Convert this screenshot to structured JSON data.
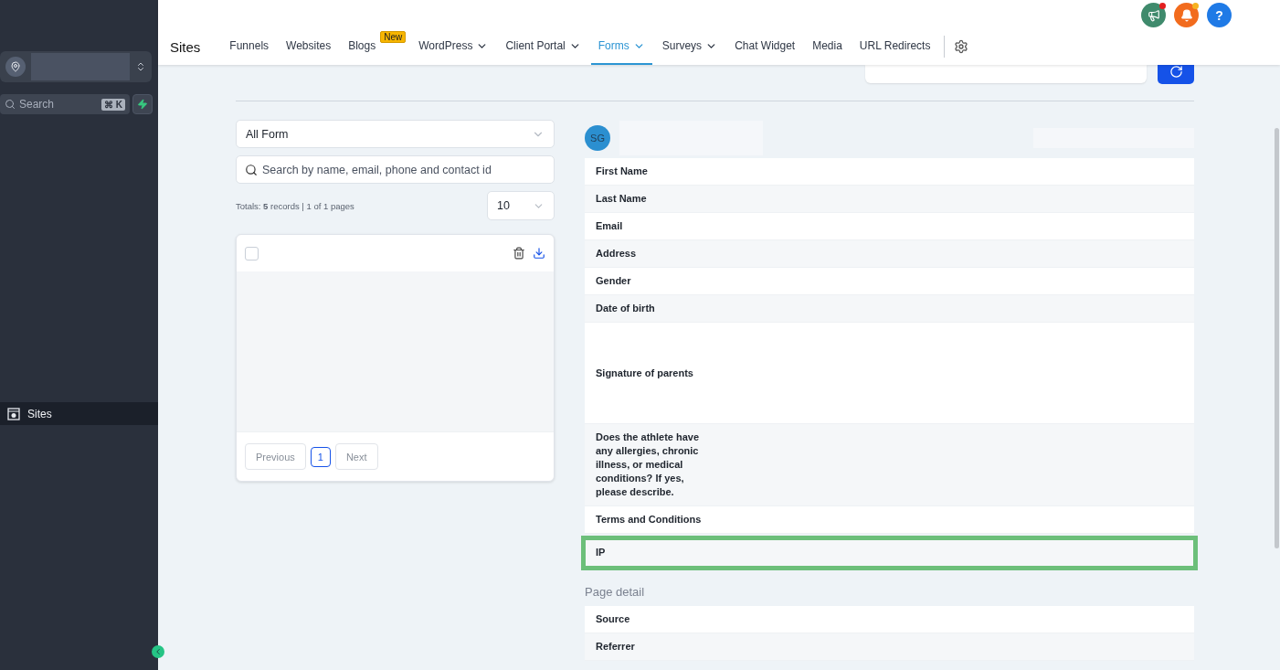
{
  "sidebar": {
    "search": {
      "placeholder": "Search",
      "shortcut": "⌘ K"
    },
    "items": [
      {
        "label": "Sites",
        "selected": true
      }
    ]
  },
  "header": {
    "title": "Sites",
    "tabs": [
      {
        "label": "Funnels",
        "selected": false,
        "dropdown": false
      },
      {
        "label": "Websites",
        "selected": false,
        "dropdown": false
      },
      {
        "label": "Blogs",
        "selected": false,
        "dropdown": false,
        "badge": "New"
      },
      {
        "label": "WordPress",
        "selected": false,
        "dropdown": true
      },
      {
        "label": "Client Portal",
        "selected": false,
        "dropdown": true
      },
      {
        "label": "Forms",
        "selected": true,
        "dropdown": true
      },
      {
        "label": "Surveys",
        "selected": false,
        "dropdown": true
      },
      {
        "label": "Chat Widget",
        "selected": false,
        "dropdown": false
      },
      {
        "label": "Media",
        "selected": false,
        "dropdown": false
      },
      {
        "label": "URL Redirects",
        "selected": false,
        "dropdown": false
      }
    ],
    "actions": [
      {
        "kind": "announcements",
        "unread": true,
        "color": "#3f8a6c"
      },
      {
        "kind": "notifications",
        "unread": true,
        "color": "#f26b1d"
      },
      {
        "kind": "help",
        "label": "?",
        "unread": false,
        "color": "#1f7ae6"
      }
    ]
  },
  "submissions": {
    "form_filter": "All Form",
    "search": {
      "placeholder": "Search by name, email, phone and contact id"
    },
    "totals": "Totals: **5** records | 1 of 1 pages",
    "page_size": "10",
    "select_all": {
      "checked": false
    },
    "pagination": [
      {
        "label": "Previous",
        "selected": false
      },
      {
        "label": "1",
        "selected": true
      },
      {
        "label": "Next",
        "selected": false
      }
    ]
  },
  "detail": {
    "initials": "SG",
    "fields": [
      {
        "label": "First Name",
        "kind": "text",
        "highlighted": false
      },
      {
        "label": "Last Name",
        "kind": "text",
        "highlighted": false
      },
      {
        "label": "Email",
        "kind": "text",
        "highlighted": false
      },
      {
        "label": "Address",
        "kind": "text",
        "highlighted": false
      },
      {
        "label": "Gender",
        "kind": "text",
        "highlighted": false
      },
      {
        "label": "Date of birth",
        "kind": "text",
        "highlighted": false
      },
      {
        "label": "Signature of parents",
        "kind": "signature",
        "highlighted": false
      },
      {
        "label": "Does the athlete have any allergies, chronic illness, or medical conditions? If yes, please describe.",
        "kind": "text",
        "highlighted": false
      },
      {
        "label": "Terms and Conditions",
        "kind": "text",
        "highlighted": false
      },
      {
        "label": "IP",
        "kind": "text",
        "highlighted": true
      }
    ],
    "page_detail": {
      "title": "Page detail",
      "fields": [
        {
          "label": "Source",
          "highlighted": false
        },
        {
          "label": "Referrer",
          "highlighted": false
        }
      ]
    }
  }
}
